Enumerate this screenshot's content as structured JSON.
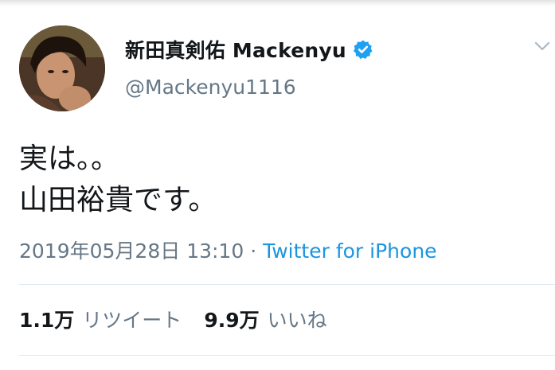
{
  "profile": {
    "display_name": "新田真剣佑 Mackenyu",
    "handle": "@Mackenyu1116"
  },
  "tweet": {
    "lines": [
      "実は。。",
      "山田裕貴です。"
    ],
    "timestamp": "2019年05月28日 13:10",
    "separator": " · ",
    "source": "Twitter for iPhone"
  },
  "stats": {
    "retweets_count": "1.1万",
    "retweets_label": "リツイート",
    "likes_count": "9.9万",
    "likes_label": "いいね"
  },
  "icons": {
    "verified": "verified-badge-icon",
    "menu": "chevron-down-icon"
  },
  "colors": {
    "link": "#1b95e0",
    "secondary_text": "#657786",
    "primary_text": "#14171a",
    "divider": "#e1e8ed",
    "verified": "#1da1f2"
  }
}
